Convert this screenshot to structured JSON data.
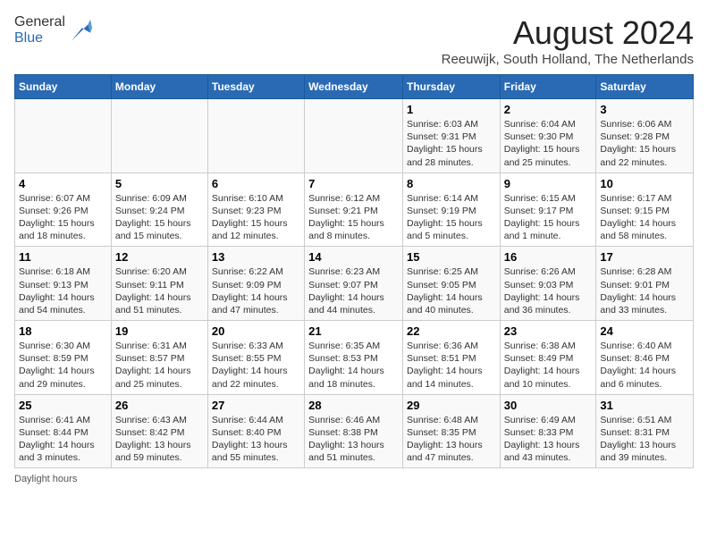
{
  "header": {
    "logo_general": "General",
    "logo_blue": "Blue",
    "month_title": "August 2024",
    "location": "Reeuwijk, South Holland, The Netherlands"
  },
  "days_of_week": [
    "Sunday",
    "Monday",
    "Tuesday",
    "Wednesday",
    "Thursday",
    "Friday",
    "Saturday"
  ],
  "weeks": [
    [
      {
        "day": "",
        "info": ""
      },
      {
        "day": "",
        "info": ""
      },
      {
        "day": "",
        "info": ""
      },
      {
        "day": "",
        "info": ""
      },
      {
        "day": "1",
        "info": "Sunrise: 6:03 AM\nSunset: 9:31 PM\nDaylight: 15 hours and 28 minutes."
      },
      {
        "day": "2",
        "info": "Sunrise: 6:04 AM\nSunset: 9:30 PM\nDaylight: 15 hours and 25 minutes."
      },
      {
        "day": "3",
        "info": "Sunrise: 6:06 AM\nSunset: 9:28 PM\nDaylight: 15 hours and 22 minutes."
      }
    ],
    [
      {
        "day": "4",
        "info": "Sunrise: 6:07 AM\nSunset: 9:26 PM\nDaylight: 15 hours and 18 minutes."
      },
      {
        "day": "5",
        "info": "Sunrise: 6:09 AM\nSunset: 9:24 PM\nDaylight: 15 hours and 15 minutes."
      },
      {
        "day": "6",
        "info": "Sunrise: 6:10 AM\nSunset: 9:23 PM\nDaylight: 15 hours and 12 minutes."
      },
      {
        "day": "7",
        "info": "Sunrise: 6:12 AM\nSunset: 9:21 PM\nDaylight: 15 hours and 8 minutes."
      },
      {
        "day": "8",
        "info": "Sunrise: 6:14 AM\nSunset: 9:19 PM\nDaylight: 15 hours and 5 minutes."
      },
      {
        "day": "9",
        "info": "Sunrise: 6:15 AM\nSunset: 9:17 PM\nDaylight: 15 hours and 1 minute."
      },
      {
        "day": "10",
        "info": "Sunrise: 6:17 AM\nSunset: 9:15 PM\nDaylight: 14 hours and 58 minutes."
      }
    ],
    [
      {
        "day": "11",
        "info": "Sunrise: 6:18 AM\nSunset: 9:13 PM\nDaylight: 14 hours and 54 minutes."
      },
      {
        "day": "12",
        "info": "Sunrise: 6:20 AM\nSunset: 9:11 PM\nDaylight: 14 hours and 51 minutes."
      },
      {
        "day": "13",
        "info": "Sunrise: 6:22 AM\nSunset: 9:09 PM\nDaylight: 14 hours and 47 minutes."
      },
      {
        "day": "14",
        "info": "Sunrise: 6:23 AM\nSunset: 9:07 PM\nDaylight: 14 hours and 44 minutes."
      },
      {
        "day": "15",
        "info": "Sunrise: 6:25 AM\nSunset: 9:05 PM\nDaylight: 14 hours and 40 minutes."
      },
      {
        "day": "16",
        "info": "Sunrise: 6:26 AM\nSunset: 9:03 PM\nDaylight: 14 hours and 36 minutes."
      },
      {
        "day": "17",
        "info": "Sunrise: 6:28 AM\nSunset: 9:01 PM\nDaylight: 14 hours and 33 minutes."
      }
    ],
    [
      {
        "day": "18",
        "info": "Sunrise: 6:30 AM\nSunset: 8:59 PM\nDaylight: 14 hours and 29 minutes."
      },
      {
        "day": "19",
        "info": "Sunrise: 6:31 AM\nSunset: 8:57 PM\nDaylight: 14 hours and 25 minutes."
      },
      {
        "day": "20",
        "info": "Sunrise: 6:33 AM\nSunset: 8:55 PM\nDaylight: 14 hours and 22 minutes."
      },
      {
        "day": "21",
        "info": "Sunrise: 6:35 AM\nSunset: 8:53 PM\nDaylight: 14 hours and 18 minutes."
      },
      {
        "day": "22",
        "info": "Sunrise: 6:36 AM\nSunset: 8:51 PM\nDaylight: 14 hours and 14 minutes."
      },
      {
        "day": "23",
        "info": "Sunrise: 6:38 AM\nSunset: 8:49 PM\nDaylight: 14 hours and 10 minutes."
      },
      {
        "day": "24",
        "info": "Sunrise: 6:40 AM\nSunset: 8:46 PM\nDaylight: 14 hours and 6 minutes."
      }
    ],
    [
      {
        "day": "25",
        "info": "Sunrise: 6:41 AM\nSunset: 8:44 PM\nDaylight: 14 hours and 3 minutes."
      },
      {
        "day": "26",
        "info": "Sunrise: 6:43 AM\nSunset: 8:42 PM\nDaylight: 13 hours and 59 minutes."
      },
      {
        "day": "27",
        "info": "Sunrise: 6:44 AM\nSunset: 8:40 PM\nDaylight: 13 hours and 55 minutes."
      },
      {
        "day": "28",
        "info": "Sunrise: 6:46 AM\nSunset: 8:38 PM\nDaylight: 13 hours and 51 minutes."
      },
      {
        "day": "29",
        "info": "Sunrise: 6:48 AM\nSunset: 8:35 PM\nDaylight: 13 hours and 47 minutes."
      },
      {
        "day": "30",
        "info": "Sunrise: 6:49 AM\nSunset: 8:33 PM\nDaylight: 13 hours and 43 minutes."
      },
      {
        "day": "31",
        "info": "Sunrise: 6:51 AM\nSunset: 8:31 PM\nDaylight: 13 hours and 39 minutes."
      }
    ]
  ],
  "footer": {
    "note": "Daylight hours"
  }
}
